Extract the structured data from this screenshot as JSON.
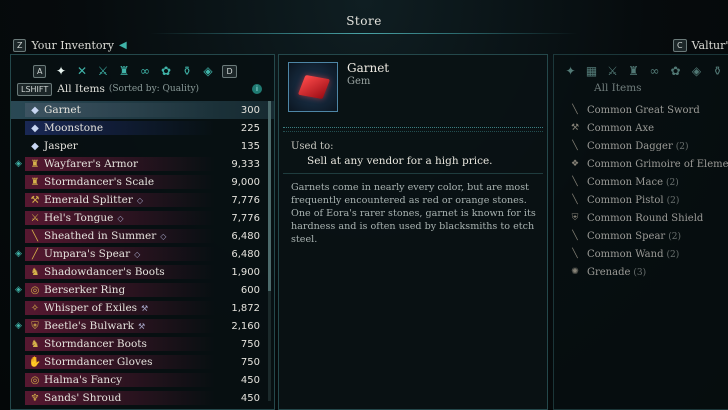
{
  "title": "Store",
  "left_header": {
    "key": "Z",
    "label": "Your Inventory",
    "arrow": "◀"
  },
  "right_header": {
    "key": "C",
    "label": "Valtur's"
  },
  "tabs_left": {
    "prev_key": "A",
    "next_key": "D",
    "icons": [
      "all-items-icon",
      "weapon-icon",
      "melee-icon",
      "armor-icon",
      "accessory-icon",
      "consumable-icon",
      "gem-icon",
      "misc-icon"
    ]
  },
  "sort": {
    "shift_key": "LSHIFT",
    "all_label": "All Items",
    "sorted_by": "(Sorted by: Quality)",
    "info": "i"
  },
  "inventory": [
    {
      "name": "Garnet",
      "value": "300",
      "quality": "common",
      "icon": "gem",
      "equipped": false,
      "tag": "",
      "selected": true
    },
    {
      "name": "Moonstone",
      "value": "225",
      "quality": "rare",
      "icon": "gem",
      "equipped": false,
      "tag": "",
      "selected": false
    },
    {
      "name": "Jasper",
      "value": "135",
      "quality": "none",
      "icon": "gem",
      "equipped": false,
      "tag": "",
      "selected": false
    },
    {
      "name": "Wayfarer's Armor",
      "value": "9,333",
      "quality": "epic",
      "icon": "armor",
      "equipped": true,
      "tag": "",
      "selected": false
    },
    {
      "name": "Stormdancer's Scale",
      "value": "9,000",
      "quality": "epic",
      "icon": "armor",
      "equipped": false,
      "tag": "",
      "selected": false
    },
    {
      "name": "Emerald Splitter",
      "value": "7,776",
      "quality": "epic",
      "icon": "axe",
      "equipped": false,
      "tag": "◇",
      "selected": false
    },
    {
      "name": "Hel's Tongue",
      "value": "7,776",
      "quality": "epic",
      "icon": "sword",
      "equipped": false,
      "tag": "◇",
      "selected": false
    },
    {
      "name": "Sheathed in Summer",
      "value": "6,480",
      "quality": "epic",
      "icon": "dagger",
      "equipped": false,
      "tag": "◇",
      "selected": false
    },
    {
      "name": "Umpara's Spear",
      "value": "6,480",
      "quality": "epic",
      "icon": "spear",
      "equipped": true,
      "tag": "◇",
      "selected": false
    },
    {
      "name": "Shadowdancer's Boots",
      "value": "1,900",
      "quality": "epic",
      "icon": "boots",
      "equipped": false,
      "tag": "",
      "selected": false
    },
    {
      "name": "Berserker Ring",
      "value": "600",
      "quality": "epic",
      "icon": "ring",
      "equipped": true,
      "tag": "",
      "selected": false
    },
    {
      "name": "Whisper of Exiles",
      "value": "1,872",
      "quality": "epic",
      "icon": "wand",
      "equipped": false,
      "tag": "⚒",
      "selected": false
    },
    {
      "name": "Beetle's Bulwark",
      "value": "2,160",
      "quality": "epic",
      "icon": "shield",
      "equipped": true,
      "tag": "⚒",
      "selected": false
    },
    {
      "name": "Stormdancer Boots",
      "value": "750",
      "quality": "epic",
      "icon": "boots",
      "equipped": false,
      "tag": "",
      "selected": false
    },
    {
      "name": "Stormdancer Gloves",
      "value": "750",
      "quality": "epic",
      "icon": "gloves",
      "equipped": false,
      "tag": "",
      "selected": false
    },
    {
      "name": "Halma's Fancy",
      "value": "450",
      "quality": "epic",
      "icon": "ring",
      "equipped": false,
      "tag": "",
      "selected": false
    },
    {
      "name": "Sands' Shroud",
      "value": "450",
      "quality": "epic",
      "icon": "cloak",
      "equipped": false,
      "tag": "",
      "selected": false
    }
  ],
  "detail": {
    "name": "Garnet",
    "type": "Gem",
    "used_label": "Used to:",
    "used_text": "Sell at any vendor for a high price.",
    "description": "Garnets come in nearly every color, but are most frequently encountered as red or orange stones. One of Eora's rarer stones, garnet is known for its hardness and is often used by blacksmiths to etch steel."
  },
  "store": {
    "sort_label": "All Items",
    "items": [
      {
        "name": "Common Great Sword",
        "count": ""
      },
      {
        "name": "Common Axe",
        "count": ""
      },
      {
        "name": "Common Dagger",
        "count": "(2)"
      },
      {
        "name": "Common Grimoire of Elements",
        "count": ""
      },
      {
        "name": "Common Mace",
        "count": "(2)"
      },
      {
        "name": "Common Pistol",
        "count": "(2)"
      },
      {
        "name": "Common Round Shield",
        "count": ""
      },
      {
        "name": "Common Spear",
        "count": "(2)"
      },
      {
        "name": "Common Wand",
        "count": "(2)"
      },
      {
        "name": "Grenade",
        "count": "(3)"
      }
    ]
  }
}
